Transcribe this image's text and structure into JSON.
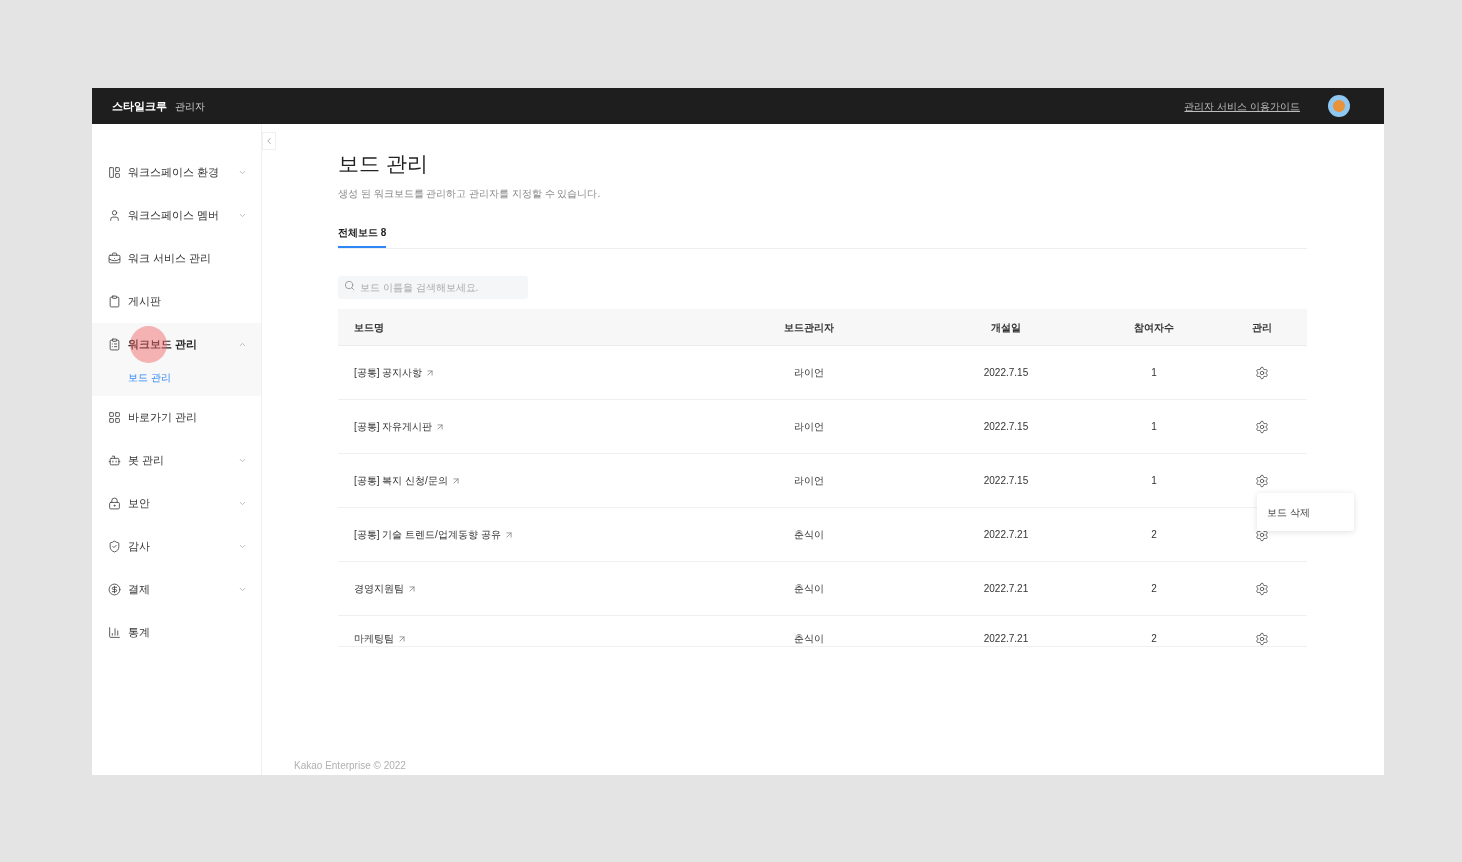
{
  "header": {
    "brand": "스타일크루",
    "role": "관리자",
    "guide_link": "관리자 서비스 이용가이드"
  },
  "sidebar": {
    "items": [
      {
        "label": "워크스페이스 환경",
        "expanded": false
      },
      {
        "label": "워크스페이스 멤버",
        "expanded": false
      },
      {
        "label": "워크 서비스 관리"
      },
      {
        "label": "게시판"
      },
      {
        "label": "워크보드 관리",
        "expanded": true,
        "children": [
          {
            "label": "보드 관리",
            "selected": true
          }
        ]
      },
      {
        "label": "바로가기 관리"
      },
      {
        "label": "봇 관리",
        "expanded": false
      },
      {
        "label": "보안",
        "expanded": false
      },
      {
        "label": "감사",
        "expanded": false
      },
      {
        "label": "결제",
        "expanded": false
      },
      {
        "label": "통계"
      }
    ]
  },
  "page": {
    "title": "보드 관리",
    "description": "생성 된 워크보드를 관리하고 관리자를 지정할 수 있습니다.",
    "tabs": [
      {
        "label": "전체보드 8",
        "selected": true
      }
    ],
    "search": {
      "placeholder": "보드 이름을 검색해보세요."
    },
    "table": {
      "columns": [
        "보드명",
        "보드관리자",
        "개설일",
        "참여자수",
        "관리"
      ],
      "rows": [
        {
          "name": "[공통] 공지사항",
          "manager": "라이언",
          "created": "2022.7.15",
          "members": "1"
        },
        {
          "name": "[공통] 자유게시판",
          "manager": "라이언",
          "created": "2022.7.15",
          "members": "1"
        },
        {
          "name": "[공통] 복지 신청/문의",
          "manager": "라이언",
          "created": "2022.7.15",
          "members": "1",
          "menu": [
            "보드 삭제"
          ]
        },
        {
          "name": "[공통] 기술 트렌드/업계동향 공유",
          "manager": "춘식이",
          "created": "2022.7.21",
          "members": "2"
        },
        {
          "name": "경영지원팀",
          "manager": "춘식이",
          "created": "2022.7.21",
          "members": "2"
        },
        {
          "name": "마케팅팀",
          "manager": "춘식이",
          "created": "2022.7.21",
          "members": "2"
        }
      ]
    }
  },
  "footer": "Kakao Enterprise © 2022"
}
